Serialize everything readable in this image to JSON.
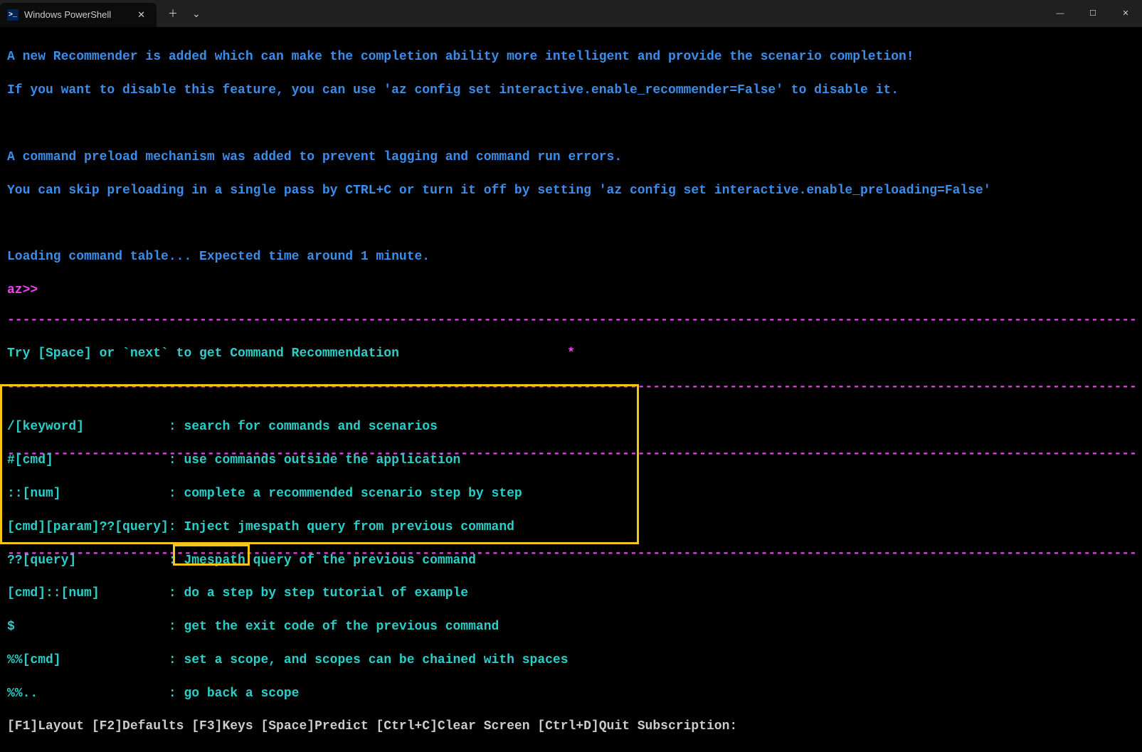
{
  "titlebar": {
    "tab_title": "Windows PowerShell",
    "close": "✕",
    "plus": "＋",
    "chevron": "⌄",
    "min": "—",
    "max": "☐",
    "winclose": "✕"
  },
  "terminal": {
    "line1": "A new Recommender is added which can make the completion ability more intelligent and provide the scenario completion!",
    "line2": "If you want to disable this feature, you can use 'az config set interactive.enable_recommender=False' to disable it.",
    "line3": "A command preload mechanism was added to prevent lagging and command run errors.",
    "line4": "You can skip preloading in a single pass by CTRL+C or turn it off by setting 'az config set interactive.enable_preloading=False'",
    "line5": "Loading command table... Expected time around 1 minute.",
    "prompt": "az>>"
  },
  "rec": {
    "divider": "----------------------------------------------------------------------------------------------------------------------------------------------------------------",
    "hint": "Try [Space] or `next` to get Command Recommendation",
    "star": "*"
  },
  "help": {
    "divider": "----------------------------------------------------------------------------------------------------------------------------------------------------------------",
    "rows": [
      {
        "key": "/[keyword]           ",
        "desc": ": search for commands and scenarios"
      },
      {
        "key": "#[cmd]               ",
        "desc": ": use commands outside the application"
      },
      {
        "key": "::[num]              ",
        "desc": ": complete a recommended scenario step by step"
      },
      {
        "key": "[cmd][param]??[query]",
        "desc": ": Inject jmespath query from previous command"
      },
      {
        "key": "??[query]            ",
        "desc": ": Jmespath query of the previous command"
      },
      {
        "key": "[cmd]::[num]         ",
        "desc": ": do a step by step tutorial of example"
      },
      {
        "key": "$                    ",
        "desc": ": get the exit code of the previous command"
      },
      {
        "key": "%%[cmd]              ",
        "desc": ": set a scope, and scopes can be chained with spaces"
      },
      {
        "key": "%%..                 ",
        "desc": ": go back a scope"
      }
    ]
  },
  "footer": {
    "text": "[F1]Layout [F2]Defaults [F3]Keys [Space]Predict [Ctrl+C]Clear Screen [Ctrl+D]Quit Subscription:"
  }
}
